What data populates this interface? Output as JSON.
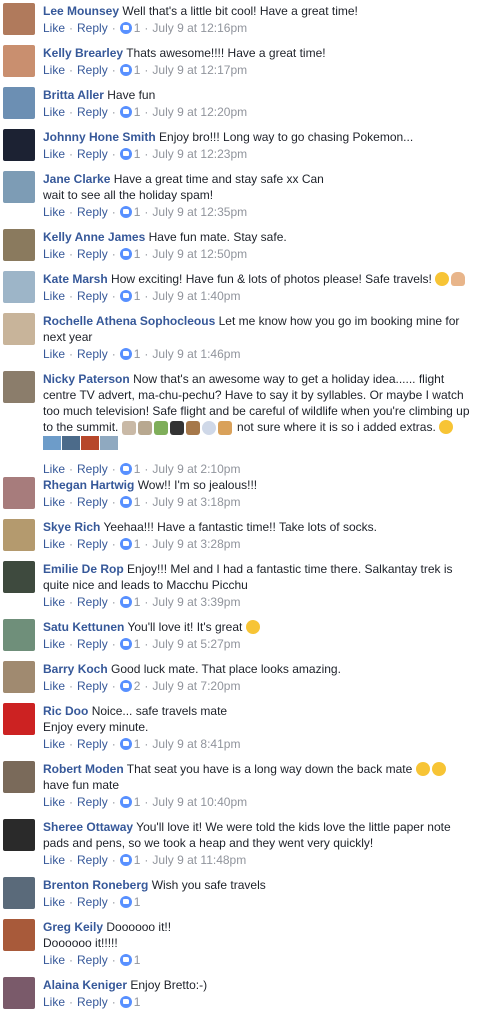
{
  "actions": {
    "like": "Like",
    "reply": "Reply",
    "dot": "·"
  },
  "comments": [
    {
      "author": "Lee Mounsey",
      "text": "Well that's a little bit cool! Have a great time!",
      "likes": "1",
      "time": "July 9 at 12:16pm",
      "avatar_color": "#b07a5c"
    },
    {
      "author": "Kelly Brearley",
      "text": "Thats awesome!!!! Have a great time!",
      "likes": "1",
      "time": "July 9 at 12:17pm",
      "avatar_color": "#c98f6f"
    },
    {
      "author": "Britta Aller",
      "text": "Have fun",
      "likes": "1",
      "time": "July 9 at 12:20pm",
      "avatar_color": "#6c8fb3"
    },
    {
      "author": "Johnny Hone Smith",
      "text": "Enjoy bro!!! Long way to go chasing Pokemon...",
      "likes": "1",
      "time": "July 9 at 12:23pm",
      "avatar_color": "#1c2233"
    },
    {
      "author": "Jane Clarke",
      "text": "Have a great time and stay safe xx Can wait to see all the holiday spam!",
      "likes": "1",
      "time": "July 9 at 12:35pm",
      "avatar_color": "#7d9cb5"
    },
    {
      "author": "Kelly Anne James",
      "text": "Have fun mate. Stay safe.",
      "likes": "1",
      "time": "July 9 at 12:50pm",
      "avatar_color": "#8a7a5e"
    },
    {
      "author": "Kate Marsh",
      "text": "How exciting! Have fun & lots of photos please! Safe travels!",
      "likes": "1",
      "time": "July 9 at 1:40pm",
      "avatar_color": "#9db5c8"
    },
    {
      "author": "Rochelle Athena Sophocleous",
      "text": "Let me know how you go im booking mine for next year",
      "likes": "1",
      "time": "July 9 at 1:46pm",
      "avatar_color": "#c8b49a"
    },
    {
      "author": "Nicky Paterson",
      "text": "Now that's an awesome way to get a holiday idea...... flight centre TV advert, ma-chu-pechu? Have to say it by syllables. Or maybe I watch too much television! Safe flight and be careful of wildlife when you're climbing up to the summit.",
      "text2": "not sure where it is so i added extras.",
      "likes": "1",
      "time": "July 9 at 2:10pm",
      "avatar_color": "#8b7d6b"
    },
    {
      "author": "Rhegan Hartwig",
      "text": "Wow!! I'm so jealous!!!",
      "likes": "1",
      "time": "July 9 at 3:18pm",
      "avatar_color": "#a77c7c"
    },
    {
      "author": "Skye Rich",
      "text": "Yeehaa!!! Have a fantastic time!! Take lots of socks.",
      "likes": "1",
      "time": "July 9 at 3:28pm",
      "avatar_color": "#b49a6e"
    },
    {
      "author": "Emilie De Rop",
      "text": "Enjoy!!! Mel and I had a fantastic time there. Salkantay trek is quite nice and leads to Macchu Picchu",
      "likes": "1",
      "time": "July 9 at 3:39pm",
      "avatar_color": "#3e4a3e"
    },
    {
      "author": "Satu Kettunen",
      "text": "You'll love it! It's great",
      "likes": "1",
      "time": "July 9 at 5:27pm",
      "avatar_color": "#6f8f7a"
    },
    {
      "author": "Barry Koch",
      "text": "Good luck mate. That place looks amazing.",
      "likes": "2",
      "time": "July 9 at 7:20pm",
      "avatar_color": "#a08a70"
    },
    {
      "author": "Ric Doo",
      "text": "Noice... safe travels mate Enjoy every minute.",
      "likes": "1",
      "time": "July 9 at 8:41pm",
      "avatar_color": "#cc2222"
    },
    {
      "author": "Robert Moden",
      "text": "That seat you have is a long way down the back mate",
      "text2": "have fun mate",
      "likes": "1",
      "time": "July 9 at 10:40pm",
      "avatar_color": "#7a6a5a"
    },
    {
      "author": "Sheree Ottaway",
      "text": "You'll love it! We were told the kids love the little paper note pads and pens, so we took a heap and they went very quickly!",
      "likes": "1",
      "time": "July 9 at 11:48pm",
      "avatar_color": "#2a2a2a"
    },
    {
      "author": "Brenton Roneberg",
      "text": "Wish you safe travels",
      "likes": "1",
      "time": "",
      "avatar_color": "#5a6a7a"
    },
    {
      "author": "Greg Keily",
      "text": "Doooooo it!! Doooooo it!!!!!",
      "likes": "1",
      "time": "",
      "avatar_color": "#a85a3a"
    },
    {
      "author": "Alaina Keniger",
      "text": "Enjoy Bretto:-)",
      "likes": "1",
      "time": "",
      "avatar_color": "#7a5a6a"
    }
  ]
}
